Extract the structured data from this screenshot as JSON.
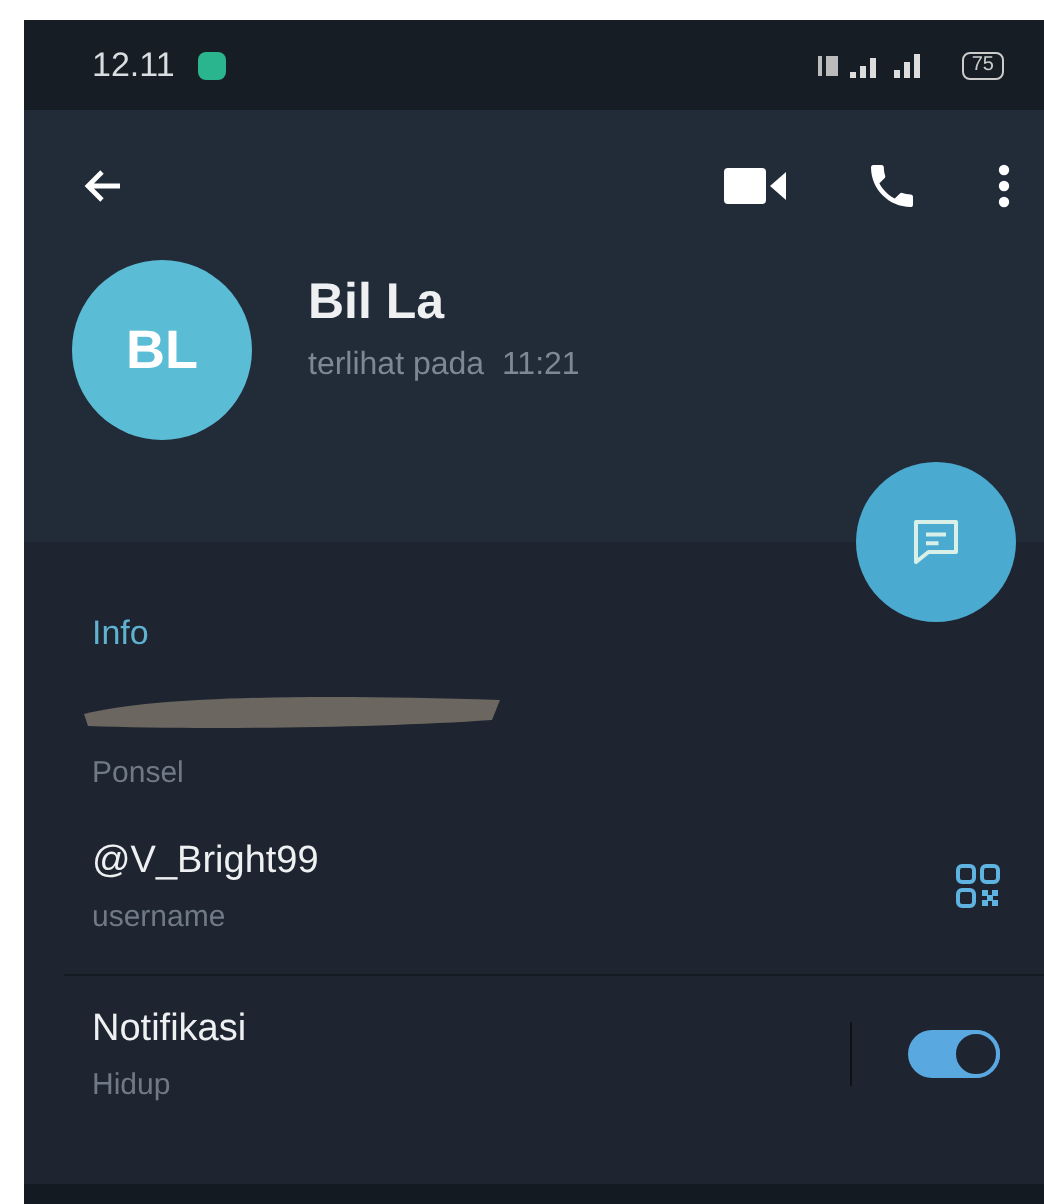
{
  "status_bar": {
    "time": "12.11",
    "battery": "75"
  },
  "profile": {
    "initials": "BL",
    "name": "Bil La",
    "last_seen": "terlihat pada  11:21"
  },
  "info": {
    "title": "Info",
    "rows": [
      {
        "kind": "phone",
        "label": "Ponsel"
      },
      {
        "kind": "username",
        "value": "@V_Bright99",
        "label": "username"
      },
      {
        "kind": "toggle",
        "value": "Notifikasi",
        "label": "Hidup",
        "on": true
      }
    ]
  }
}
